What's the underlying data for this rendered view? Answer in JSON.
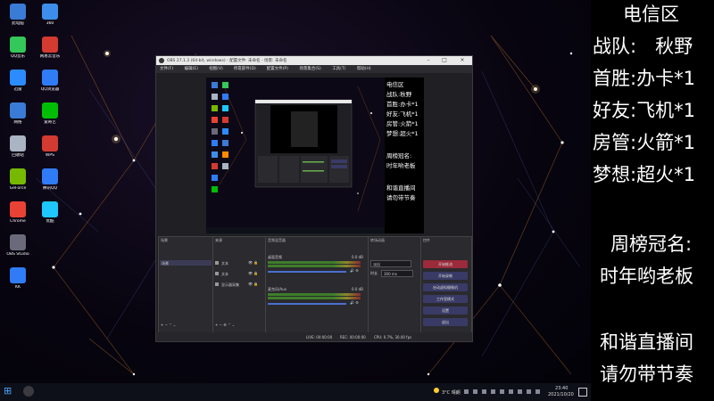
{
  "info_panel": {
    "lines": [
      "电信区",
      "战队:　秋野",
      "首胜:办卡*1",
      "好友:飞机*1",
      "房管:火箭*1",
      "梦想:超火*1",
      "周榜冠名:",
      "时年哟老板",
      "和谐直播间",
      "请勿带节奏"
    ],
    "color": "#ffffff"
  },
  "desktop_icons": [
    {
      "label": "此电脑",
      "color": "#3a7bd5"
    },
    {
      "label": "QQ音乐",
      "color": "#34c759"
    },
    {
      "label": "迅雷",
      "color": "#2a8cff"
    },
    {
      "label": "网络",
      "color": "#3a7bd5"
    },
    {
      "label": "回收站",
      "color": "#aab4c3"
    },
    {
      "label": "GeForce",
      "color": "#76b900"
    },
    {
      "label": "Chrome",
      "color": "#e94235"
    },
    {
      "label": "OBS Studio",
      "color": "#6a6a7a"
    },
    {
      "label": "KK",
      "color": "#2f7cf6"
    },
    {
      "label": "360",
      "color": "#3d8eea"
    },
    {
      "label": "网易云音乐",
      "color": "#d33a31"
    },
    {
      "label": "QQ浏览器",
      "color": "#2f7cf6"
    },
    {
      "label": "爱奇艺",
      "color": "#00be06"
    },
    {
      "label": "WPS",
      "color": "#d33a31"
    },
    {
      "label": "腾讯QQ",
      "color": "#2f7cf6"
    },
    {
      "label": "优酷",
      "color": "#1ec8ff"
    }
  ],
  "obs": {
    "title": "OBS 27.1.3 (64-bit, windows) - 配置文件: 未命名 - 场景: 未命名",
    "menu": [
      "文件(F)",
      "编辑(E)",
      "视图(V)",
      "停靠部件(D)",
      "配置文件(P)",
      "场景集合(S)",
      "工具(T)",
      "帮助(H)"
    ],
    "docks": {
      "scenes_title": "场景",
      "scene_item": "场景",
      "sources_title": "来源",
      "sources": [
        "文本",
        "文本",
        "显示器采集"
      ],
      "mixer_title": "音频混音器",
      "mixer_channels": [
        {
          "name": "桌面音频",
          "db": "0.0 dB"
        },
        {
          "name": "麦克风/Aux",
          "db": "0.0 dB"
        }
      ],
      "transitions_title": "转场动画",
      "transition_value": "淡出",
      "duration_label": "时长",
      "duration_value": "300 ms",
      "controls_title": "控件",
      "controls": [
        "开始推流",
        "开始录制",
        "启动虚拟摄像机",
        "工作室模式",
        "设置",
        "退出"
      ]
    },
    "status": {
      "live": "LIVE: 00:00:00",
      "rec": "REC: 00:00:00",
      "cpu": "CPU: 0.7%, 30.00 fps"
    },
    "nested_preview_lines": [
      "电信区",
      "战队:秋野",
      "首胜:办卡*1",
      "好友:飞机*1",
      "房管:火箭*1",
      "梦想:超火*1",
      "周榜冠名:",
      "时年哟老板",
      "和谐直播间",
      "请勿带节奏"
    ]
  },
  "taskbar": {
    "temp": "3°C 晴朗",
    "time": "23:40",
    "date": "2021/10/20"
  }
}
